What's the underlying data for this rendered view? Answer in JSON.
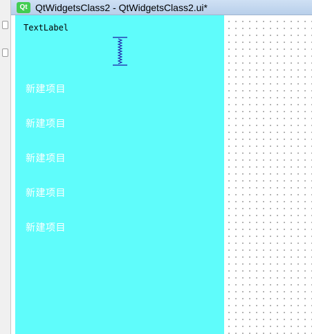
{
  "window": {
    "icon_text": "Qt",
    "title": "QtWidgetsClass2 - QtWidgetsClass2.ui*"
  },
  "form": {
    "text_label": "TextLabel",
    "items": [
      {
        "label": "新建项目"
      },
      {
        "label": "新建项目"
      },
      {
        "label": "新建项目"
      },
      {
        "label": "新建项目"
      },
      {
        "label": "新建项目"
      }
    ]
  },
  "colors": {
    "frame_background": "#5ffcfb",
    "item_text": "#ffffff",
    "spacer": "#1a1aa6",
    "qt_icon": "#41cd52"
  },
  "icons": {
    "app": "qt-logo-icon",
    "spacer": "vertical-spacer-icon"
  }
}
